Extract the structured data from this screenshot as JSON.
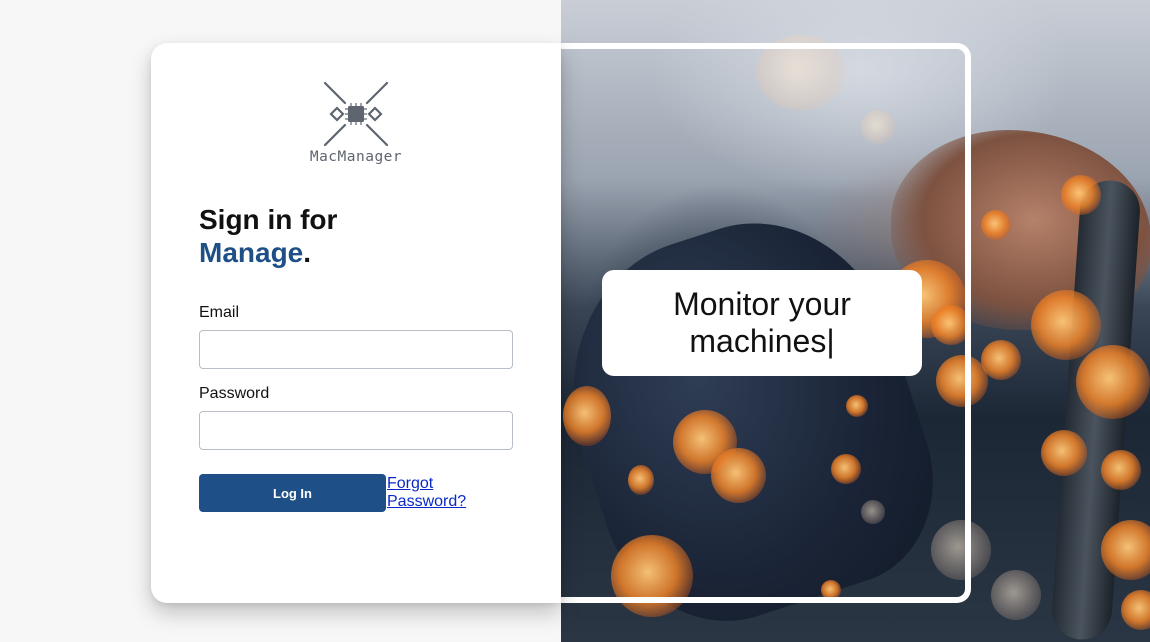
{
  "brand": {
    "name": "MacManager",
    "icon": "chip-cross-logo-icon"
  },
  "heading": {
    "line1": "Sign in for",
    "accent": "Manage",
    "punct": "."
  },
  "form": {
    "email_label": "Email",
    "email_value": "",
    "password_label": "Password",
    "password_value": "",
    "login_label": "Log In",
    "forgot_label": "Forgot Password?"
  },
  "tagline": {
    "text": "Monitor your machines|"
  },
  "colors": {
    "accent": "#1e4f86",
    "link": "#0a28c8",
    "background": "#f7f7f7"
  }
}
